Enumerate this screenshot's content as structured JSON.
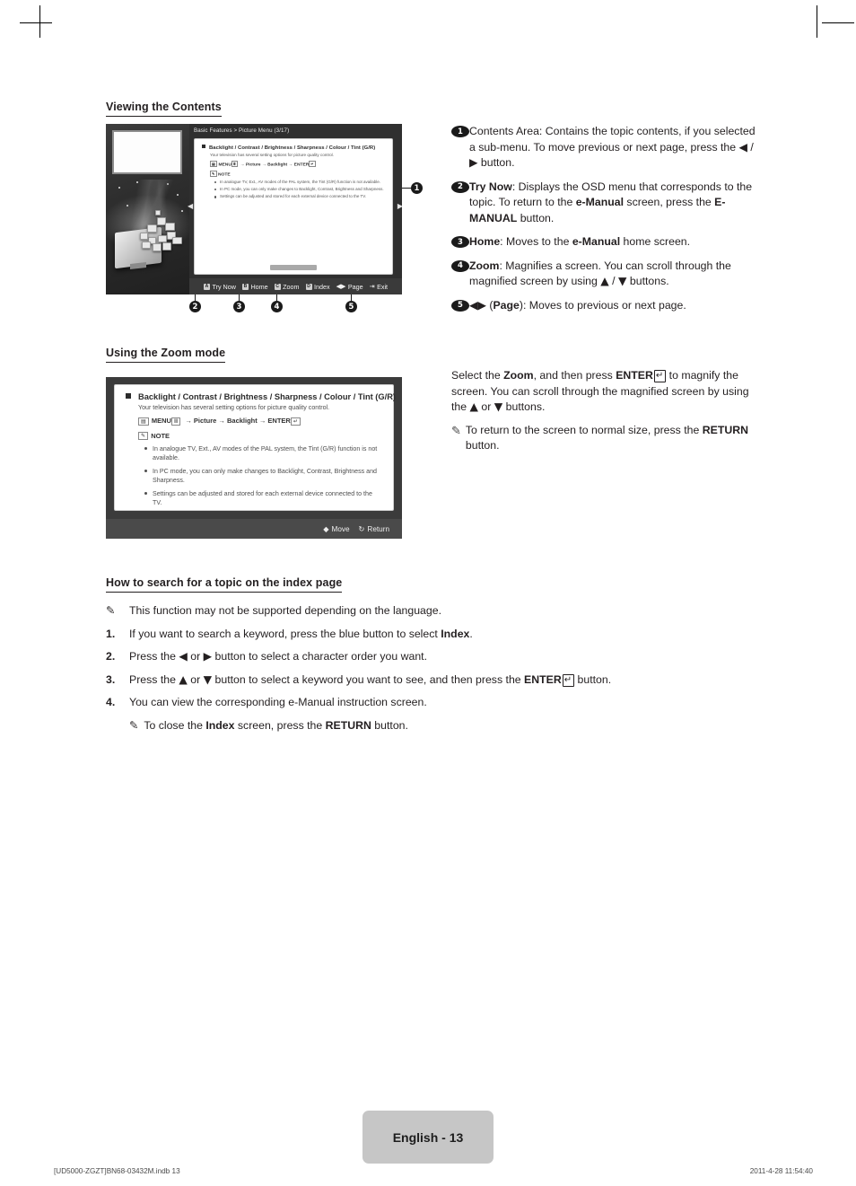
{
  "sections": {
    "viewing_contents_heading": "Viewing the Contents",
    "zoom_mode_heading": "Using the Zoom mode",
    "index_search_heading": "How to search for a topic on the index page"
  },
  "figure_contents": {
    "breadcrumb": "Basic Features > Picture Menu (3/17)",
    "title": "Backlight / Contrast / Brightness / Sharpness / Colour / Tint (G/R)",
    "subtitle": "Your television has several setting options for picture quality control.",
    "path_badge": "MENU",
    "path": "→ Picture → Backlight → ENTER",
    "note_label": "NOTE",
    "bullets": [
      "In analogue TV, Ext., AV modes of the PAL system, the Tint (G/R) function is not available.",
      "In PC mode, you can only make changes to Backlight, Contrast, Brightness and Sharpness.",
      "Settings can be adjusted and stored for each external device connected to the TV."
    ],
    "buttons": [
      {
        "key": "A",
        "label": "Try Now"
      },
      {
        "key": "B",
        "label": "Home"
      },
      {
        "key": "C",
        "label": "Zoom"
      },
      {
        "key": "D",
        "label": "Index"
      },
      {
        "key": "◀▶",
        "label": "Page"
      },
      {
        "key": "⇥",
        "label": "Exit"
      }
    ],
    "callouts": [
      "1",
      "2",
      "3",
      "4",
      "5"
    ]
  },
  "contents_legend": [
    {
      "num": "1",
      "html": "Contents Area: Contains the topic contents, if you selected a sub-menu. To move previous or next page, press the <span class=\"glyph\">◀</span> / <span class=\"glyph\">▶</span> button."
    },
    {
      "num": "2",
      "html": "<b>Try Now</b>: Displays the OSD menu that corresponds to the topic. To return to the <b>e-Manual</b> screen, press the <b>E-MANUAL</b> button."
    },
    {
      "num": "3",
      "html": "<b>Home</b>: Moves to the <b>e-Manual</b> home screen."
    },
    {
      "num": "4",
      "html": "<b>Zoom</b>: Magnifies a screen. You can scroll through the magnified screen by using <span class=\"glyph\">▲</span> / <span class=\"glyph\">▼</span> buttons."
    },
    {
      "num": "5",
      "html": "<span class=\"glyph\">◀▶</span> (<b>Page</b>): Moves to previous or next page."
    }
  ],
  "figure_zoom": {
    "title": "Backlight / Contrast / Brightness / Sharpness / Colour / Tint (G/R)",
    "subtitle": "Your television has several setting options for picture quality control.",
    "path_badge": "MENU",
    "path": "→ Picture → Backlight → ENTER",
    "note_label": "NOTE",
    "bullets": [
      "In analogue TV, Ext., AV modes of the PAL system, the Tint (G/R) function is not available.",
      "In PC mode, you can only make changes to Backlight, Contrast, Brightness and Sharpness.",
      "Settings can be adjusted and stored for each external device connected to the TV."
    ],
    "footer_items": [
      {
        "glyph": "◆",
        "label": "Move"
      },
      {
        "glyph": "↻",
        "label": "Return"
      }
    ]
  },
  "zoom_instructions": {
    "paragraph_html": "Select the <b>Zoom</b>, and then press <b>ENTER</b><span class=\"enterbox\">↵</span> to magnify the screen. You can scroll through the magnified screen by using the <span class=\"glyph\">▲</span> or <span class=\"glyph\">▼</span> buttons.",
    "note_html": "To return to the screen to normal size, press the <b>RETURN</b> button."
  },
  "index_steps": {
    "intro_note_html": "This function may not be supported depending on the language.",
    "items": [
      {
        "num": "1.",
        "html": "If you want to search a keyword, press the blue button to select <b>Index</b>."
      },
      {
        "num": "2.",
        "html": "Press the <span class=\"glyph\">◀</span> or <span class=\"glyph\">▶</span> button to select a character order you want."
      },
      {
        "num": "3.",
        "html": "Press the <span class=\"glyph\">▲</span> or <span class=\"glyph\">▼</span> button to select a keyword you want to see, and then press the <b>ENTER</b><span class=\"enterbox\">↵</span> button."
      },
      {
        "num": "4.",
        "html": "You can view the corresponding e-Manual instruction screen."
      }
    ],
    "closing_note_html": "To close the <b>Index</b> screen, press the <b>RETURN</b> button."
  },
  "footer": {
    "page_label": "English - 13",
    "file_info": "[UD5000-ZGZT]BN68-03432M.indb   13",
    "timestamp": "2011-4-28   11:54:40"
  }
}
